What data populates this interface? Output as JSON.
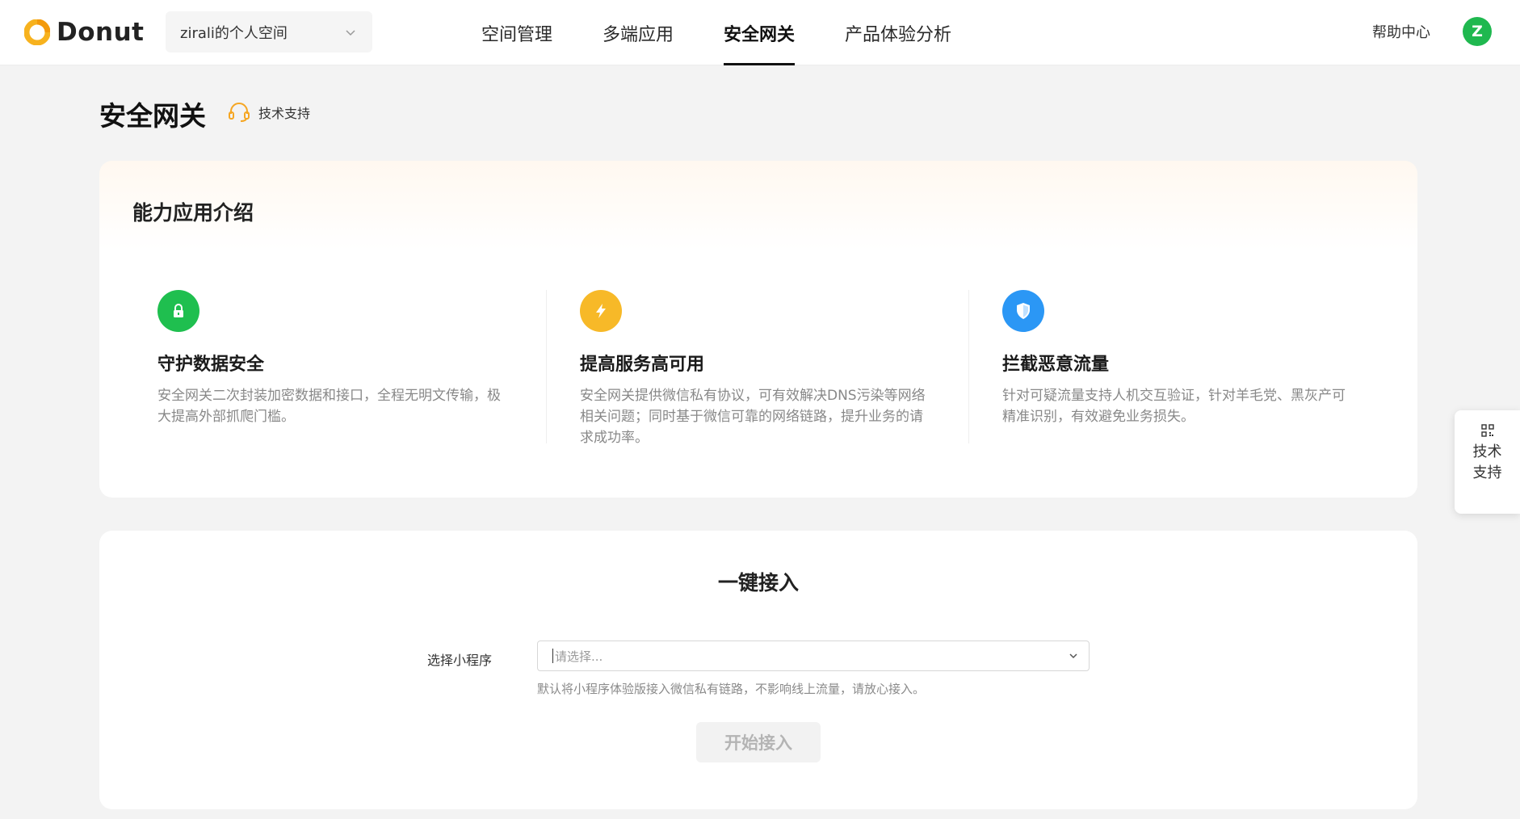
{
  "header": {
    "logo_text": "Donut",
    "space_selector": "zirali的个人空间",
    "nav": [
      {
        "label": "空间管理",
        "active": false
      },
      {
        "label": "多端应用",
        "active": false
      },
      {
        "label": "安全网关",
        "active": true
      },
      {
        "label": "产品体验分析",
        "active": false
      }
    ],
    "help": "帮助中心",
    "avatar_letter": "Z"
  },
  "page": {
    "title": "安全网关",
    "support_link": "技术支持"
  },
  "intro": {
    "title": "能力应用介绍",
    "features": [
      {
        "icon": "lock-icon",
        "color": "#1fbf4f",
        "title": "守护数据安全",
        "desc": "安全网关二次封装加密数据和接口，全程无明文传输，极大提高外部抓爬门槛。"
      },
      {
        "icon": "lightning-icon",
        "color": "#f7b928",
        "title": "提高服务高可用",
        "desc": "安全网关提供微信私有协议，可有效解决DNS污染等网络相关问题；同时基于微信可靠的网络链路，提升业务的请求成功率。"
      },
      {
        "icon": "shield-icon",
        "color": "#2b97f5",
        "title": "拦截恶意流量",
        "desc": "针对可疑流量支持人机交互验证，针对羊毛党、黑灰产可精准识别，有效避免业务损失。"
      }
    ]
  },
  "access": {
    "title": "一键接入",
    "field_label": "选择小程序",
    "select_placeholder": "请选择...",
    "hint": "默认将小程序体验版接入微信私有链路，不影响线上流量，请放心接入。",
    "start_button": "开始接入"
  },
  "float_widget": {
    "label": "技术支持"
  }
}
